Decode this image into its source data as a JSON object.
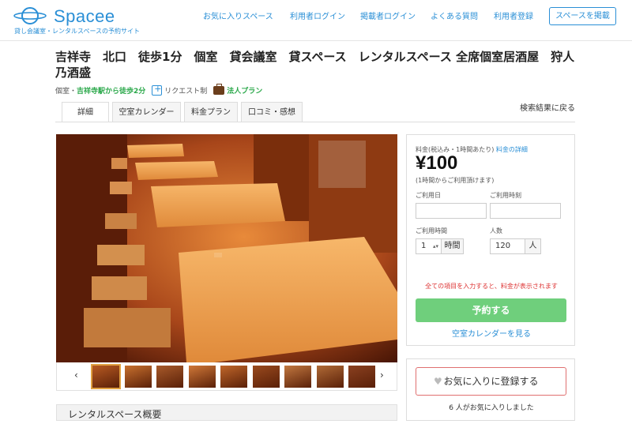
{
  "header": {
    "logo_text": "Spacee",
    "logo_sub": "貸し会議室・レンタルスペースの予約サイト",
    "nav": [
      "お気に入りスペース",
      "利用者ログイン",
      "掲載者ログイン",
      "よくある質問",
      "利用者登録"
    ],
    "post_button": "スペースを掲載"
  },
  "title": "吉祥寺　北口　徒歩1分　個室　貸会議室　貸スペース　レンタルスペース 全席個室居酒屋　狩人乃酒盛",
  "meta": {
    "type": "個室・",
    "access": "吉祥寺駅から徒歩2分",
    "request": "リクエスト制",
    "corporate": "法人プラン"
  },
  "tabs": [
    "詳細",
    "空室カレンダー",
    "料金プラン",
    "口コミ・感想"
  ],
  "back_link": "検索結果に戻る",
  "gallery": {
    "prev": "‹",
    "next": "›",
    "thumb_count": 9,
    "selected_index": 0
  },
  "overview_heading": "レンタルスペース概要",
  "booking": {
    "price_caption": "料金(税込み・1時間あたり)",
    "price_detail_link": "料金の詳細",
    "price": "¥100",
    "price_note": "(1時間からご利用頂けます)",
    "date_label": "ご利用日",
    "time_label": "ご利用時刻",
    "duration_label": "ご利用時間",
    "duration_value": "1",
    "duration_unit": "時間",
    "people_label": "人数",
    "people_value": "120",
    "people_unit": "人",
    "notice": "全ての項目を入力すると、料金が表示されます",
    "reserve_button": "予約する",
    "calendar_link": "空室カレンダーを見る"
  },
  "favorite": {
    "button": "お気に入りに登録する",
    "count_text": "6 人がお気に入りしました"
  },
  "colors": {
    "brand": "#2a8fd6",
    "reserve": "#6fcf7c",
    "notice": "#dd3333",
    "access_green": "#2aa84a"
  }
}
